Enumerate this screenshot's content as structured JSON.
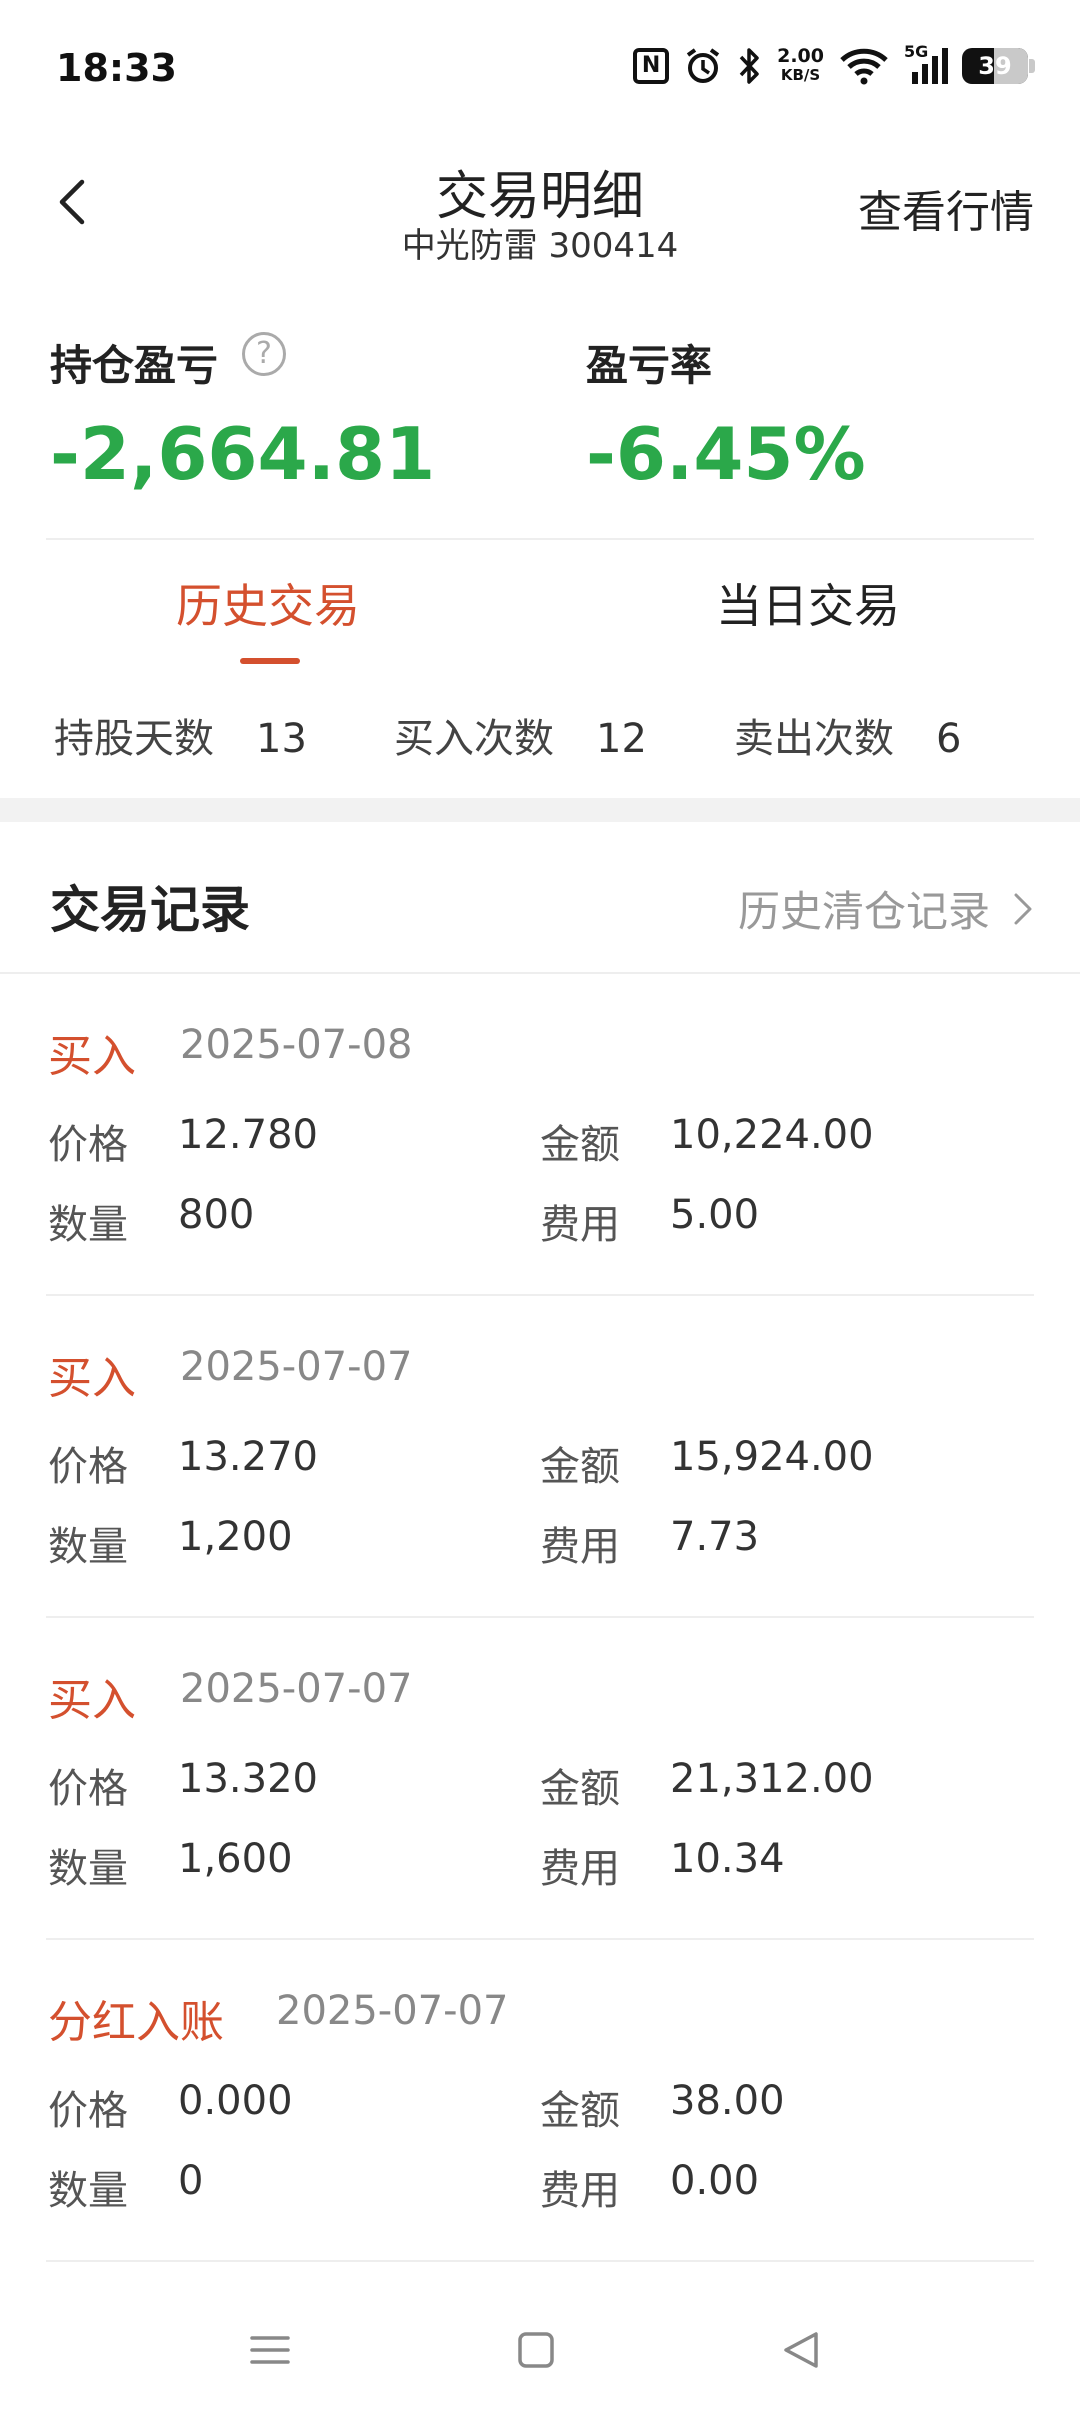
{
  "status_bar": {
    "time": "18:33",
    "net_speed": "2.00",
    "net_unit": "KB/S",
    "battery": "39",
    "signal_label": "5G"
  },
  "header": {
    "title": "交易明细",
    "subtitle": "中光防雷  300414",
    "right_link": "查看行情"
  },
  "summary": {
    "pnl_label": "持仓盈亏",
    "pnl_value": "-2,664.81",
    "rate_label": "盈亏率",
    "rate_value": "-6.45%",
    "value_color": "#2ba84a"
  },
  "tabs": [
    {
      "label": "历史交易",
      "active": true
    },
    {
      "label": "当日交易",
      "active": false
    }
  ],
  "stats": [
    {
      "label": "持股天数",
      "value": "13"
    },
    {
      "label": "买入次数",
      "value": "12"
    },
    {
      "label": "卖出次数",
      "value": "6"
    }
  ],
  "records_section": {
    "title": "交易记录",
    "history_link": "历史清仓记录"
  },
  "field_labels": {
    "price": "价格",
    "amount": "金额",
    "qty": "数量",
    "fee": "费用"
  },
  "records": [
    {
      "type": "买入",
      "date": "2025-07-08",
      "price": "12.780",
      "amount": "10,224.00",
      "qty": "800",
      "fee": "5.00"
    },
    {
      "type": "买入",
      "date": "2025-07-07",
      "price": "13.270",
      "amount": "15,924.00",
      "qty": "1,200",
      "fee": "7.73"
    },
    {
      "type": "买入",
      "date": "2025-07-07",
      "price": "13.320",
      "amount": "21,312.00",
      "qty": "1,600",
      "fee": "10.34"
    },
    {
      "type": "分红入账",
      "date": "2025-07-07",
      "price": "0.000",
      "amount": "38.00",
      "qty": "0",
      "fee": "0.00"
    }
  ],
  "colors": {
    "accent": "#d4502e",
    "loss": "#2ba84a"
  }
}
